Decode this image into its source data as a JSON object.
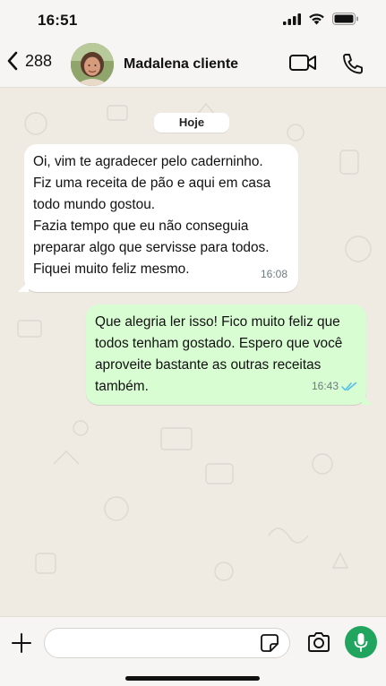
{
  "status_bar": {
    "time": "16:51",
    "icons": [
      "signal-icon",
      "wifi-icon",
      "battery-icon"
    ]
  },
  "header": {
    "back_icon": "chevron-left-icon",
    "unread_count": "288",
    "contact_name": "Madalena cliente",
    "video_icon": "video-camera-icon",
    "call_icon": "phone-icon"
  },
  "chat": {
    "date_label": "Hoje",
    "messages": [
      {
        "direction": "incoming",
        "lines": [
          "Oi, vim te agradecer pelo caderninho.",
          "Fiz uma receita de pão e aqui em casa",
          "todo mundo gostou.",
          "Fazia tempo que eu não conseguia",
          "preparar algo que servisse para todos.",
          "Fiquei muito feliz mesmo."
        ],
        "time": "16:08"
      },
      {
        "direction": "outgoing",
        "lines": [
          "Que alegria ler isso! Fico muito feliz que",
          "todos tenham gostado. Espero que você",
          "aproveite bastante as outras receitas",
          "também."
        ],
        "time": "16:43",
        "status_icon": "double-check-icon"
      }
    ]
  },
  "composer": {
    "plus_icon": "plus-icon",
    "input_value": "",
    "sticker_icon": "sticker-icon",
    "camera_icon": "camera-icon",
    "mic_icon": "microphone-icon"
  },
  "colors": {
    "chat_background": "#efeae2",
    "outgoing_bubble": "#d9fdd3",
    "incoming_bubble": "#ffffff",
    "accent_green": "#21a45d",
    "read_receipt_blue": "#53bdeb"
  }
}
